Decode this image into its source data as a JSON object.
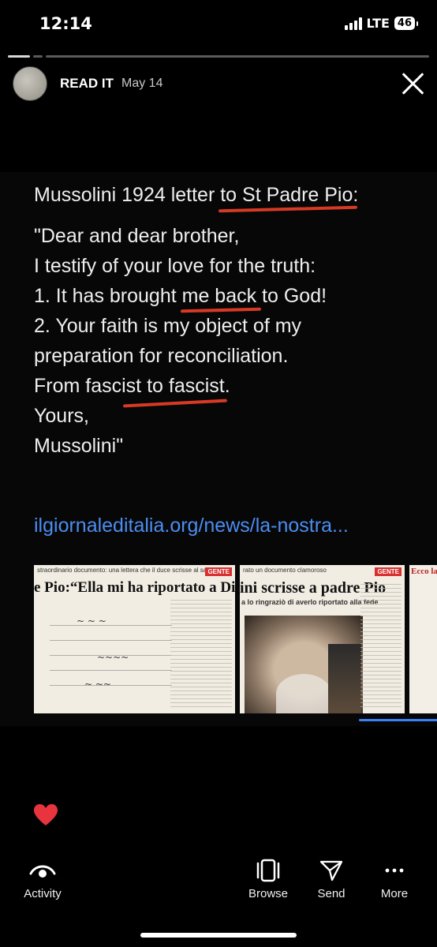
{
  "status": {
    "time": "12:14",
    "network": "LTE",
    "battery": "46"
  },
  "story": {
    "author": "READ IT",
    "date": "May 14",
    "progress_segments_done": 1,
    "progress_segments_total": 3
  },
  "post": {
    "intro_before": "Mussolini 1924 letter ",
    "intro_highlight": "to St Padre Pio",
    "intro_after": ":",
    "line1": "\"Dear and dear brother,",
    "line2": "I testify of your love for the truth:",
    "line3_before": "1. It has brought ",
    "line3_highlight": "me back",
    "line3_after": " to God!",
    "line4": "2. Your faith is my object of my",
    "line5": "preparation for reconciliation.",
    "line6_before": "From fascist ",
    "line6_highlight": "to fascist.",
    "line7": "Yours,",
    "line8": "Mussolini\"",
    "link": "ilgiornaleditalia.org/news/la-nostra..."
  },
  "gallery": [
    {
      "strip": "straordinario documento: una lettera che il duce scrisse al santo frate",
      "badge": "GENTE",
      "headline": "e Pio:“Ella mi ha riportato a Dio!”"
    },
    {
      "strip": "rato un documento clamoroso",
      "badge": "GENTE",
      "headline": "ini scrisse a padre Pio",
      "subline": "a lo ringraziò di averlo riportato alla fede"
    },
    {
      "headline": "Ecco la"
    }
  ],
  "colors": {
    "underline": "#d73a24",
    "link": "#4b8df0",
    "heart": "#e8343f",
    "indicator": "#3b82f6"
  },
  "nav": {
    "activity": "Activity",
    "browse": "Browse",
    "send": "Send",
    "more": "More"
  }
}
